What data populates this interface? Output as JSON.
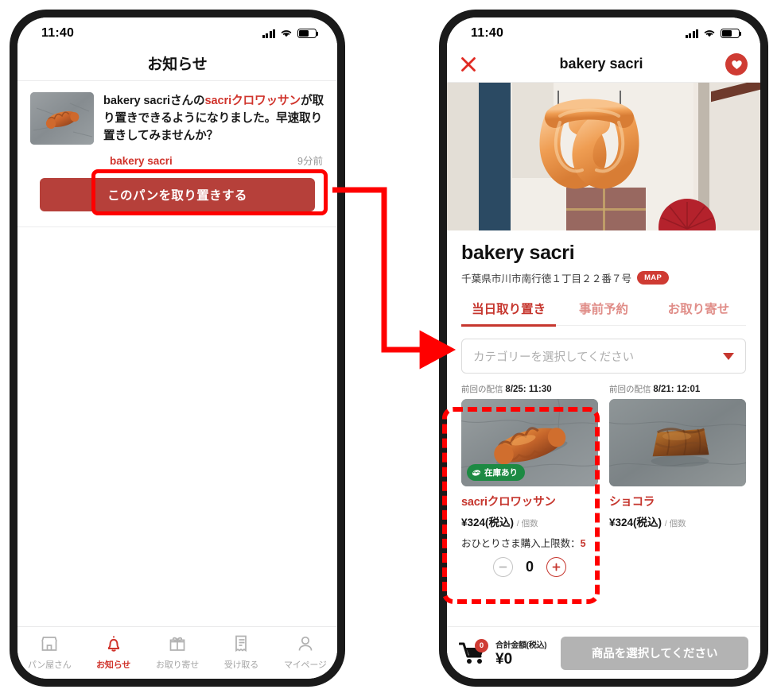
{
  "left_phone": {
    "status": {
      "time": "11:40",
      "signal_icon": "signal-bars-icon",
      "wifi_icon": "wifi-icon",
      "battery_icon": "battery-icon"
    },
    "nav_title": "お知らせ",
    "notification": {
      "thumbnail_icon": "croissant-photo",
      "text_before": "bakery sacriさんの",
      "text_highlight": "sacriクロワッサン",
      "text_after": "が取り置きできるようになりました。早速取り置きしてみませんか？",
      "shop": "bakery sacri",
      "time": "9分前",
      "cta_label": "このパンを取り置きする"
    },
    "tabbar": [
      {
        "label": "パン屋さん",
        "icon": "storefront-icon",
        "active": false
      },
      {
        "label": "お知らせ",
        "icon": "bell-icon",
        "active": true
      },
      {
        "label": "お取り寄せ",
        "icon": "gift-icon",
        "active": false
      },
      {
        "label": "受け取る",
        "icon": "receipt-icon",
        "active": false
      },
      {
        "label": "マイページ",
        "icon": "person-icon",
        "active": false
      }
    ]
  },
  "right_phone": {
    "status": {
      "time": "11:40",
      "signal_icon": "signal-bars-icon",
      "wifi_icon": "wifi-icon",
      "battery_icon": "battery-icon"
    },
    "header": {
      "close_icon": "close-x-icon",
      "title": "bakery sacri",
      "favorite_icon": "heart-icon"
    },
    "hero_image": "pretzel-shop-sign-photo",
    "shop": {
      "name": "bakery sacri",
      "address": "千葉県市川市南行徳１丁目２２番７号",
      "map_label": "MAP"
    },
    "tabs": [
      {
        "label": "当日取り置き",
        "active": true
      },
      {
        "label": "事前予約",
        "active": false
      },
      {
        "label": "お取り寄せ",
        "active": false
      }
    ],
    "category_select": {
      "placeholder": "カテゴリーを選択してください",
      "caret_icon": "caret-down-icon"
    },
    "products": [
      {
        "meta_label": "前回の配信",
        "meta_value": "8/25: 11:30",
        "image": "croissant-photo",
        "stock_badge": "在庫あり",
        "stock_badge_icon": "bread-icon",
        "name": "sacriクロワッサン",
        "price": "¥324(税込)",
        "unit": "/ 個数",
        "limit_label": "おひとりさま購入上限数：",
        "limit_value": "5",
        "quantity": "0",
        "minus_icon": "minus-circle-icon",
        "plus_icon": "plus-circle-icon"
      },
      {
        "meta_label": "前回の配信",
        "meta_value": "8/21: 12:01",
        "image": "pain-au-chocolat-photo",
        "name": "ショコラ",
        "price": "¥324(税込)",
        "unit": "/ 個数"
      }
    ],
    "cart": {
      "icon": "shopping-cart-icon",
      "badge_count": "0",
      "total_label": "合計金額(税込)",
      "total_amount": "¥0",
      "submit_label": "商品を選択してください"
    }
  },
  "annotations": {
    "highlight_color": "#ff0000",
    "cta_highlight_name": "cta-button-highlight",
    "product_highlight_name": "product-card-highlight",
    "arrow_name": "flow-arrow"
  },
  "theme": {
    "brand_red": "#cf3b33",
    "button_red": "#b6403a",
    "stock_green": "#1d8a43",
    "disabled_gray": "#b3b3b3",
    "annotation_red": "#ff0000"
  }
}
